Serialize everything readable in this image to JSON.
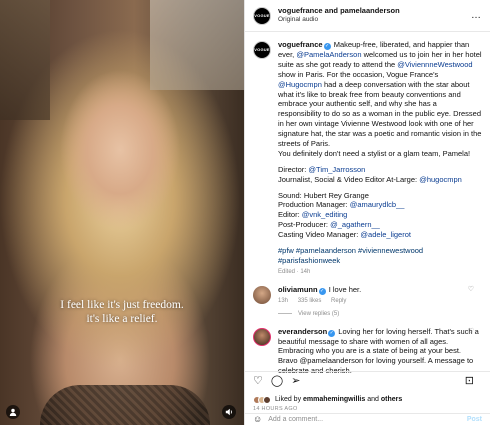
{
  "video": {
    "subtitle_line1": "I feel like it's just freedom.",
    "subtitle_line2": "it's like a relief.",
    "user_tag_icon": "person-icon",
    "mute_icon": "speaker-icon"
  },
  "header": {
    "logo_text": "VOGUE",
    "usernames": "voguefrance and pamelaanderson",
    "audio": "Original audio",
    "more_icon": "…"
  },
  "caption": {
    "username": "voguefrance",
    "p1_a": "Makeup-free, liberated, and happier than ever, ",
    "p1_mention1": "@PamelaAnderson",
    "p1_b": " welcomed us to join her in her hotel suite as she got ready to attend the ",
    "p1_mention2": "@ViviennneWestwood",
    "p1_c": " show in Paris. For the occasion, Vogue France's ",
    "p1_mention3": "@Hugocmpn",
    "p1_d": " had a deep conversation with the star about what it's like to break free from beauty conventions and embrace your authentic self, and why she has a responsibility to do so as a woman in the public eye. Dressed in her own vintage Vivienne Westwood look with one of her signature hat, the star was a poetic and romantic vision in the streets of Paris.",
    "p2": "You definitely don't need a stylist or a glam team, Pamela!",
    "director_label": "Director: ",
    "director": "@Tim_Jarrosson",
    "journalist_label": "Journalist, Social & Video Editor At-Large: ",
    "journalist": "@hugocmpn",
    "sound": "Sound: Hubert Rey Grange",
    "pm_label": "Production Manager: ",
    "pm": "@amaurydlcb__",
    "editor_label": "Editor: ",
    "editor": "@vnk_editing",
    "post_label": "Post-Producer: ",
    "post": "@_agathern__",
    "casting_label": "Casting Video Manager: ",
    "casting": "@adele_ligerot",
    "hashtags": "#pfw #pamelaanderson #viviennewestwood #parisfashionweek",
    "meta": "Edited · 14h"
  },
  "comments": [
    {
      "username": "oliviamunn",
      "verified": "✓",
      "text": "I love her.",
      "time": "13h",
      "likes": "335 likes",
      "reply": "Reply",
      "view_replies": "View replies (5)"
    },
    {
      "username": "everanderson",
      "verified": "✓",
      "text": "Loving her for loving herself. That's such a beautiful message to share with women of all ages. Embracing who you are is a state of being at your best. Bravo @pamelaanderson for loving yourself. A message to celebrate and cherish."
    }
  ],
  "actions": {
    "like_icon": "♡",
    "comment_icon": "◯",
    "share_icon": "➢",
    "save_icon": "⊡"
  },
  "likes": {
    "prefix": "Liked by ",
    "user": "emmahemingwillis",
    "suffix": " and ",
    "others": "others"
  },
  "date": "14 HOURS AGO",
  "add_comment": {
    "placeholder": "Add a comment...",
    "post": "Post",
    "emoji_icon": "☺"
  }
}
